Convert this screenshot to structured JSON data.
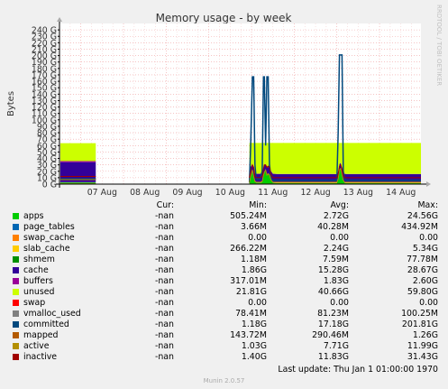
{
  "chart_data": {
    "type": "area",
    "title": "Memory usage - by week",
    "ylabel": "Bytes",
    "watermark": "RRDTOOL / TOBI OETIKER",
    "x_ticks": [
      "07 Aug",
      "08 Aug",
      "09 Aug",
      "10 Aug",
      "11 Aug",
      "12 Aug",
      "13 Aug",
      "14 Aug"
    ],
    "xlim_days": [
      6.5,
      14.97
    ],
    "ylim": [
      0,
      250
    ],
    "y_ticks": [
      0,
      10,
      20,
      30,
      40,
      50,
      60,
      70,
      80,
      90,
      100,
      110,
      120,
      130,
      140,
      150,
      160,
      170,
      180,
      190,
      200,
      210,
      220,
      230,
      240
    ],
    "y_tick_suffix": " G",
    "grid": true,
    "data_segments": [
      {
        "x": [
          6.52,
          7.35
        ],
        "stack": [
          {
            "name": "apps",
            "values": [
              2.5,
              2.5
            ]
          },
          {
            "name": "page_tables",
            "values": [
              0.05,
              0.05
            ]
          },
          {
            "name": "slab_cache",
            "values": [
              0.5,
              0.5
            ]
          },
          {
            "name": "cache",
            "values": [
              31,
              31
            ]
          },
          {
            "name": "buffers",
            "values": [
              1.7,
              1.7
            ]
          },
          {
            "name": "unused",
            "values": [
              28,
              28
            ]
          }
        ],
        "lines": [
          {
            "name": "committed",
            "values": [
              8,
              8
            ]
          },
          {
            "name": "vmalloc_used",
            "values": [
              0.08,
              0.08
            ]
          },
          {
            "name": "mapped",
            "values": [
              0.3,
              0.3
            ]
          },
          {
            "name": "active",
            "values": [
              7,
              7
            ]
          },
          {
            "name": "inactive",
            "values": [
              12,
              12
            ]
          }
        ]
      },
      {
        "x": [
          10.95,
          10.98,
          11.02,
          11.05,
          11.08,
          11.11,
          11.14,
          11.2,
          11.25,
          11.28,
          11.3,
          11.33,
          11.36,
          11.39,
          11.42,
          11.46,
          11.5,
          11.6,
          11.7,
          11.8,
          11.9,
          12.0,
          12.1,
          12.2,
          12.3,
          12.4,
          12.5,
          12.6,
          12.7,
          12.8,
          12.9,
          13.0,
          13.03,
          13.06,
          13.09,
          13.12,
          13.15,
          13.18,
          13.22,
          13.3,
          13.4,
          13.5,
          13.6,
          13.7,
          13.8,
          13.9,
          14.0,
          14.1,
          14.2,
          14.3,
          14.4,
          14.5,
          14.6,
          14.7,
          14.8,
          14.9,
          14.97
        ],
        "stack": [
          {
            "name": "apps",
            "values": [
              1.5,
              12,
              22,
              12,
              5,
              2,
              2,
              2,
              3,
              14,
              18,
              22,
              14,
              16,
              14,
              6,
              2,
              1.5,
              1.5,
              1.5,
              1.5,
              1.5,
              1.5,
              1.5,
              1.5,
              1.5,
              1.5,
              1.5,
              1.5,
              1.5,
              1.5,
              1.5,
              8,
              22,
              24,
              14,
              6,
              2,
              1.5,
              1.5,
              1.5,
              1.5,
              1.5,
              1.5,
              1.5,
              1.5,
              1.5,
              1.5,
              1.5,
              1.5,
              1.5,
              1.5,
              1.5,
              1.5,
              1.5,
              1.5,
              1.5
            ]
          },
          {
            "name": "page_tables",
            "values": [
              0.05,
              0.05,
              0.05,
              0.05,
              0.05,
              0.05,
              0.05,
              0.05,
              0.05,
              0.05,
              0.05,
              0.05,
              0.05,
              0.05,
              0.05,
              0.05,
              0.05,
              0.05,
              0.05,
              0.05,
              0.05,
              0.05,
              0.05,
              0.05,
              0.05,
              0.05,
              0.05,
              0.05,
              0.05,
              0.05,
              0.05,
              0.05,
              0.05,
              0.05,
              0.05,
              0.05,
              0.05,
              0.05,
              0.05,
              0.05,
              0.05,
              0.05,
              0.05,
              0.05,
              0.05,
              0.05,
              0.05,
              0.05,
              0.05,
              0.05,
              0.05,
              0.05,
              0.05,
              0.05,
              0.05,
              0.05,
              0.05
            ]
          },
          {
            "name": "slab_cache",
            "values": [
              1,
              1,
              1,
              1,
              1,
              1,
              1,
              1,
              1,
              1,
              1,
              1,
              1,
              1,
              1,
              1,
              1,
              1,
              1,
              1,
              1,
              1,
              1,
              1,
              1,
              1,
              1,
              1,
              1,
              1,
              1,
              1,
              1,
              1,
              1,
              1,
              1,
              1,
              1,
              1,
              1,
              1,
              1,
              1,
              1,
              1,
              1,
              1,
              1,
              1,
              1,
              1,
              1,
              1,
              1,
              1,
              1
            ]
          },
          {
            "name": "cache",
            "values": [
              13,
              14,
              8,
              14,
              10,
              13,
              13,
              13,
              13,
              10,
              10,
              8,
              10,
              10,
              10,
              13,
              13,
              13,
              13,
              13,
              13,
              13,
              13,
              13,
              13,
              13,
              13,
              13,
              13,
              13,
              13,
              13,
              10,
              8,
              8,
              10,
              13,
              13,
              13,
              13,
              13,
              13,
              13,
              13,
              13,
              13,
              13,
              13,
              13,
              13,
              13,
              13,
              13,
              13,
              13,
              13,
              13
            ]
          },
          {
            "name": "buffers",
            "values": [
              0.3,
              0.3,
              0.3,
              0.3,
              0.3,
              0.3,
              0.3,
              0.3,
              0.3,
              0.3,
              0.3,
              0.3,
              0.3,
              0.3,
              0.3,
              0.3,
              0.3,
              0.3,
              0.3,
              0.3,
              0.3,
              0.3,
              0.3,
              0.3,
              0.3,
              0.3,
              0.3,
              0.3,
              0.3,
              0.3,
              0.3,
              0.3,
              0.3,
              0.3,
              0.3,
              0.3,
              0.3,
              0.3,
              0.3,
              0.3,
              0.3,
              0.3,
              0.3,
              0.3,
              0.3,
              0.3,
              0.3,
              0.3,
              0.3,
              0.3,
              0.3,
              0.3,
              0.3,
              0.3,
              0.3,
              0.3,
              0.3
            ]
          },
          {
            "name": "unused",
            "values": [
              48.2,
              36.7,
              32.7,
              36.7,
              47.7,
              47.7,
              47.7,
              47.7,
              46.7,
              38.7,
              34.7,
              32.7,
              38.7,
              36.7,
              38.7,
              43.7,
              47.7,
              48.2,
              48.2,
              48.2,
              48.2,
              48.2,
              48.2,
              48.2,
              48.2,
              48.2,
              48.2,
              48.2,
              48.2,
              48.2,
              48.2,
              48.2,
              44.7,
              32.7,
              30.7,
              38.7,
              43.7,
              47.7,
              48.2,
              48.2,
              48.2,
              48.2,
              48.2,
              48.2,
              48.2,
              48.2,
              48.2,
              48.2,
              48.2,
              48.2,
              48.2,
              48.2,
              48.2,
              48.2,
              48.2,
              48.2,
              48.2
            ]
          }
        ],
        "lines": [
          {
            "name": "committed",
            "values": [
              2,
              60,
              167,
              167,
              30,
              8,
              8,
              8,
              20,
              167,
              167,
              60,
              167,
              167,
              30,
              8,
              6,
              6,
              6,
              6,
              6,
              6,
              6,
              6,
              6,
              6,
              6,
              6,
              6,
              6,
              6,
              6,
              80,
              201,
              201,
              201,
              20,
              8,
              6,
              6,
              6,
              6,
              6,
              6,
              6,
              6,
              6,
              6,
              6,
              6,
              6,
              6,
              6,
              6,
              6,
              6,
              6
            ]
          },
          {
            "name": "vmalloc_used",
            "values": [
              0.08,
              0.08,
              0.08,
              0.08,
              0.08,
              0.08,
              0.08,
              0.08,
              0.08,
              0.08,
              0.08,
              0.08,
              0.08,
              0.08,
              0.08,
              0.08,
              0.08,
              0.08,
              0.08,
              0.08,
              0.08,
              0.08,
              0.08,
              0.08,
              0.08,
              0.08,
              0.08,
              0.08,
              0.08,
              0.08,
              0.08,
              0.08,
              0.08,
              0.08,
              0.08,
              0.08,
              0.08,
              0.08,
              0.08,
              0.08,
              0.08,
              0.08,
              0.08,
              0.08,
              0.08,
              0.08,
              0.08,
              0.08,
              0.08,
              0.08,
              0.08,
              0.08,
              0.08,
              0.08,
              0.08,
              0.08,
              0.08
            ]
          },
          {
            "name": "mapped",
            "values": [
              0.2,
              0.2,
              0.2,
              0.2,
              0.2,
              0.2,
              0.2,
              0.2,
              0.2,
              0.2,
              0.2,
              0.2,
              0.2,
              0.2,
              0.2,
              0.2,
              0.2,
              0.2,
              0.2,
              0.2,
              0.2,
              0.2,
              0.2,
              0.2,
              0.2,
              0.2,
              0.2,
              0.2,
              0.2,
              0.2,
              0.2,
              0.2,
              0.2,
              0.2,
              0.2,
              0.2,
              0.2,
              0.2,
              0.2,
              0.2,
              0.2,
              0.2,
              0.2,
              0.2,
              0.2,
              0.2,
              0.2,
              0.2,
              0.2,
              0.2,
              0.2,
              0.2,
              0.2,
              0.2,
              0.2,
              0.2,
              0.2
            ]
          },
          {
            "name": "active",
            "values": [
              2,
              12,
              22,
              12,
              4,
              3,
              3,
              3,
              4,
              14,
              18,
              22,
              14,
              16,
              14,
              6,
              3,
              3,
              3,
              3,
              3,
              3,
              3,
              3,
              3,
              3,
              3,
              3,
              3,
              3,
              3,
              3,
              8,
              22,
              24,
              14,
              6,
              3,
              3,
              3,
              3,
              3,
              3,
              3,
              3,
              3,
              3,
              3,
              3,
              3,
              3,
              3,
              3,
              3,
              3,
              3,
              3
            ]
          },
          {
            "name": "inactive",
            "values": [
              10,
              20,
              30,
              26,
              12,
              10,
              10,
              10,
              12,
              24,
              30,
              30,
              26,
              28,
              26,
              14,
              10,
              10,
              10,
              10,
              10,
              10,
              10,
              10,
              10,
              10,
              10,
              10,
              10,
              10,
              10,
              10,
              16,
              28,
              30,
              24,
              14,
              10,
              10,
              10,
              10,
              10,
              10,
              10,
              10,
              10,
              10,
              10,
              10,
              10,
              10,
              10,
              10,
              10,
              10,
              10,
              10
            ]
          }
        ]
      }
    ],
    "colors": {
      "apps": "#00cc00",
      "page_tables": "#0066b3",
      "swap_cache": "#ff8000",
      "slab_cache": "#ffcc00",
      "shmem": "#330099",
      "cache": "#990099",
      "buffers": "#ccff00",
      "unused": "#ff0000",
      "swap": "#808080",
      "vmalloc_used": "#008f00",
      "committed": "#00487d",
      "mapped": "#b35a00",
      "active": "#b38f00",
      "inactive": "#6b006b"
    },
    "area_colors": {
      "apps": "#00cc00",
      "page_tables": "#0066b3",
      "slab_cache": "#ffcc00",
      "cache": "#330099",
      "buffers": "#990099",
      "unused": "#ccff00"
    },
    "line_colors": {
      "committed": "#00487d",
      "vmalloc_used": "#808080",
      "mapped": "#b35a00",
      "active": "#b38f00",
      "inactive": "#a00000"
    }
  },
  "legend": {
    "headers": {
      "cur": "Cur:",
      "min": "Min:",
      "avg": "Avg:",
      "max": "Max:"
    },
    "rows": [
      {
        "name": "apps",
        "color": "#00cc00",
        "cur": "-nan",
        "min": "505.24M",
        "avg": "2.72G",
        "max": "24.56G"
      },
      {
        "name": "page_tables",
        "color": "#0066b3",
        "cur": "-nan",
        "min": "3.66M",
        "avg": "40.28M",
        "max": "434.92M"
      },
      {
        "name": "swap_cache",
        "color": "#ff8000",
        "cur": "-nan",
        "min": "0.00",
        "avg": "0.00",
        "max": "0.00"
      },
      {
        "name": "slab_cache",
        "color": "#ffcc00",
        "cur": "-nan",
        "min": "266.22M",
        "avg": "2.24G",
        "max": "5.34G"
      },
      {
        "name": "shmem",
        "color": "#008f00",
        "cur": "-nan",
        "min": "1.18M",
        "avg": "7.59M",
        "max": "77.78M"
      },
      {
        "name": "cache",
        "color": "#330099",
        "cur": "-nan",
        "min": "1.86G",
        "avg": "15.28G",
        "max": "28.67G"
      },
      {
        "name": "buffers",
        "color": "#990099",
        "cur": "-nan",
        "min": "317.01M",
        "avg": "1.83G",
        "max": "2.60G"
      },
      {
        "name": "unused",
        "color": "#ccff00",
        "cur": "-nan",
        "min": "21.81G",
        "avg": "40.66G",
        "max": "59.80G"
      },
      {
        "name": "swap",
        "color": "#ff0000",
        "cur": "-nan",
        "min": "0.00",
        "avg": "0.00",
        "max": "0.00"
      },
      {
        "name": "vmalloc_used",
        "color": "#808080",
        "cur": "-nan",
        "min": "78.41M",
        "avg": "81.23M",
        "max": "100.25M"
      },
      {
        "name": "committed",
        "color": "#00487d",
        "cur": "-nan",
        "min": "1.18G",
        "avg": "17.18G",
        "max": "201.81G"
      },
      {
        "name": "mapped",
        "color": "#b35a00",
        "cur": "-nan",
        "min": "143.72M",
        "avg": "290.46M",
        "max": "1.26G"
      },
      {
        "name": "active",
        "color": "#b38f00",
        "cur": "-nan",
        "min": "1.03G",
        "avg": "7.71G",
        "max": "11.99G"
      },
      {
        "name": "inactive",
        "color": "#a00000",
        "cur": "-nan",
        "min": "1.40G",
        "avg": "11.83G",
        "max": "31.43G"
      }
    ]
  },
  "footer": {
    "last_update": "Last update: Thu Jan  1 01:00:00 1970",
    "version": "Munin 2.0.57"
  }
}
